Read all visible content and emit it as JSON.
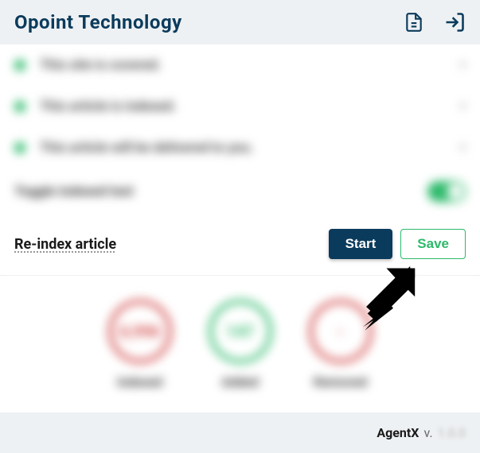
{
  "header": {
    "title": "Opoint Technology"
  },
  "status_items": [
    {
      "text": "This site is covered."
    },
    {
      "text": "This article is indexed."
    },
    {
      "text": "This article will be delivered to you."
    }
  ],
  "toggle_row": {
    "label": "Toggle indexed text"
  },
  "reindex": {
    "label": "Re-index article",
    "start": "Start",
    "save": "Save"
  },
  "stats": [
    {
      "value": "6,996",
      "label": "Indexed",
      "color": "red"
    },
    {
      "value": "147",
      "label": "Added",
      "color": "green"
    },
    {
      "value": "-",
      "label": "Removed",
      "color": "redthin"
    }
  ],
  "footer": {
    "name": "AgentX",
    "v": "v.",
    "version": "1.0.0"
  }
}
